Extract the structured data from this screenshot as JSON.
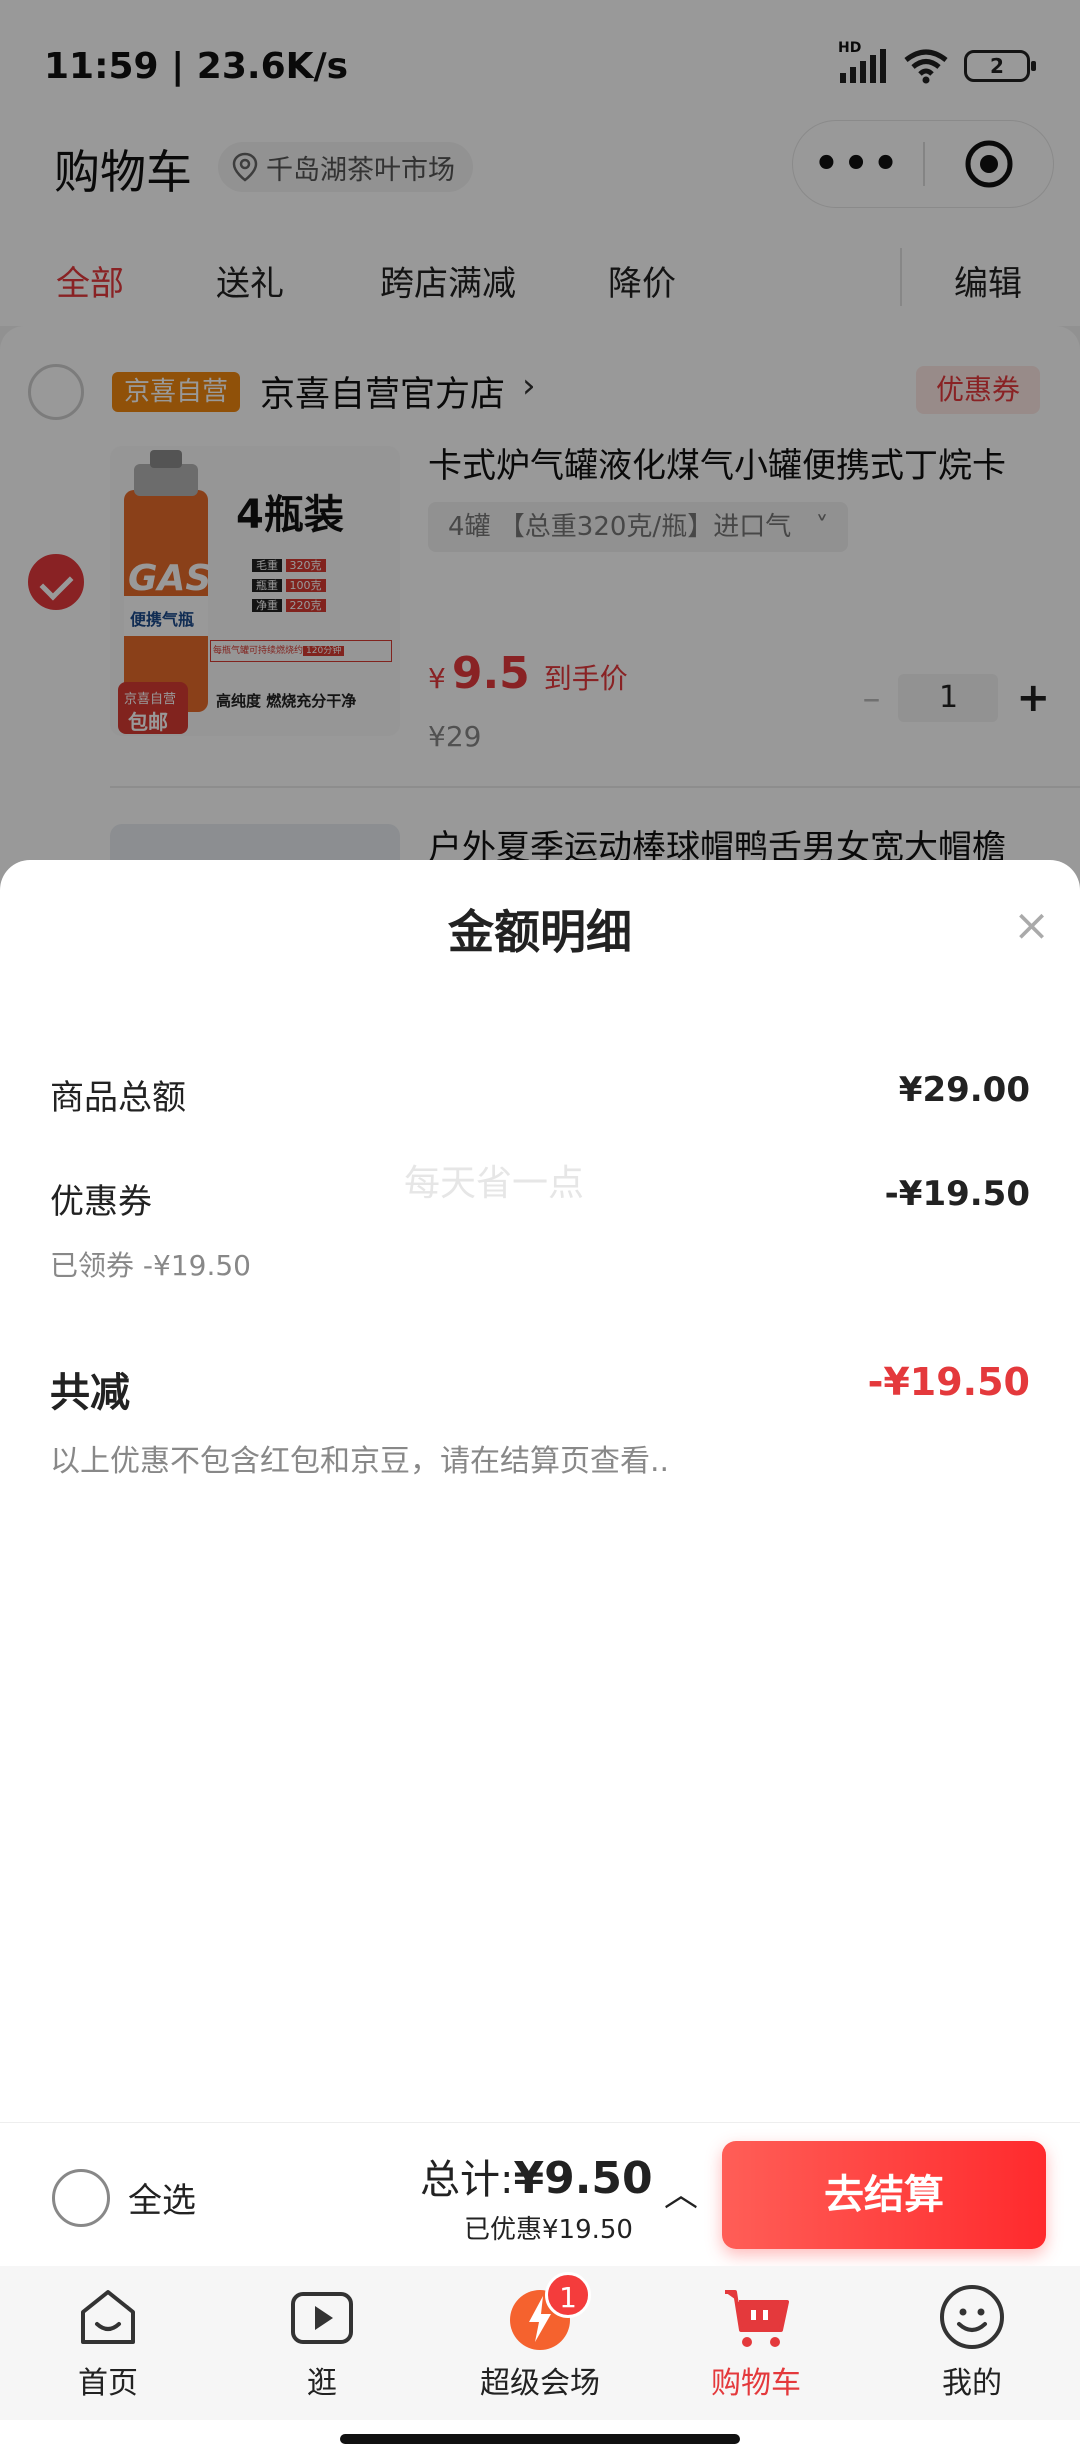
{
  "status_bar": {
    "time": "11:59 | 23.6K/s",
    "battery": "2",
    "signal_label": "HD"
  },
  "header": {
    "title": "购物车",
    "location": "千岛湖茶叶市场",
    "capsule_more": "•••"
  },
  "tabs": [
    {
      "label": "全部",
      "active": true
    },
    {
      "label": "送礼",
      "active": false
    },
    {
      "label": "跨店满减",
      "active": false
    },
    {
      "label": "降价",
      "active": false
    },
    {
      "label": "编辑",
      "active": false
    }
  ],
  "store": {
    "badge": "京喜自营",
    "name": "京喜自营官方店",
    "coupon_label": "优惠券"
  },
  "product": {
    "title": "卡式炉气罐液化煤气小罐便携式丁烷卡",
    "spec": "4罐 【总重320克/瓶】进口气",
    "price_yen": "¥",
    "price": "9.5",
    "price_tag": "到手价",
    "original_price": "¥29",
    "quantity": "1",
    "image": {
      "headline": "4瓶装",
      "can_text": "GAS",
      "can_sub": "便携气瓶",
      "rows": [
        {
          "k": "毛重",
          "v": "320克"
        },
        {
          "k": "瓶重",
          "v": "100克"
        },
        {
          "k": "净重",
          "v": "220克"
        }
      ],
      "strip_left": "每瓶气罐可持续燃烧约",
      "strip_right": "120分钟",
      "stamp_top": "京喜自营",
      "stamp_bottom": "包邮",
      "bottom_text": "高纯度 燃烧充分干净"
    }
  },
  "product2": {
    "title": "户外夏季运动棒球帽鸭舌男女宽大帽檐"
  },
  "sheet": {
    "title": "金额明细",
    "close": "×",
    "goods_total_label": "商品总额",
    "goods_total_value": "¥29.00",
    "coupon_label": "优惠券",
    "coupon_value": "-¥19.50",
    "coupon_note": "已领券 -¥19.50",
    "watermark": "每天省一点",
    "total_discount_label": "共减",
    "total_discount_value": "-¥19.50",
    "footnote": "以上优惠不包含红包和京豆，请在结算页查看.."
  },
  "checkout": {
    "select_all": "全选",
    "total_label": "总计:",
    "total_value": "¥9.50",
    "saved": "已优惠¥19.50",
    "expand": "︿",
    "button": "去结算"
  },
  "tabbar": [
    {
      "label": "首页",
      "icon": "home-icon",
      "active": false
    },
    {
      "label": "逛",
      "icon": "video-icon",
      "active": false
    },
    {
      "label": "超级会场",
      "icon": "venue-icon",
      "active": false,
      "badge": "1"
    },
    {
      "label": "购物车",
      "icon": "cart-icon",
      "active": true
    },
    {
      "label": "我的",
      "icon": "profile-icon",
      "active": false
    }
  ],
  "colors": {
    "accent": "#e4393c",
    "store_badge": "#f0870f",
    "checkout_gradient_start": "#ff5e57",
    "checkout_gradient_end": "#ff2a2d"
  }
}
